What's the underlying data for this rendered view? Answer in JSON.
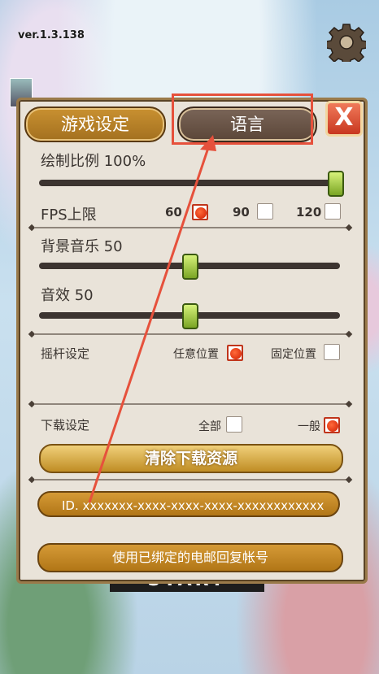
{
  "version": "ver.1.3.138",
  "background": {
    "start_text": "START"
  },
  "tabs": {
    "game_settings": "游戏设定",
    "language": "语言"
  },
  "close_label": "X",
  "render_scale": {
    "label": "绘制比例 100%",
    "value_percent": 100
  },
  "fps": {
    "label": "FPS上限",
    "options": [
      "60",
      "90",
      "120"
    ],
    "selected": "60"
  },
  "bgm": {
    "label": "背景音乐 50",
    "value": 50
  },
  "sfx": {
    "label": "音效 50",
    "value": 50
  },
  "joystick": {
    "label": "摇杆设定",
    "options": [
      "任意位置",
      "固定位置"
    ],
    "selected": "任意位置"
  },
  "download": {
    "label": "下载设定",
    "options": [
      "全部",
      "一般"
    ],
    "selected": "一般"
  },
  "buttons": {
    "clear_download": "清除下载资源",
    "id_text": "ID. xxxxxxx-xxxx-xxxx-xxxx-xxxxxxxxxxxx",
    "recover": "使用已绑定的电邮回复帐号"
  },
  "colors": {
    "highlight": "#e6513c",
    "panel_bg": "#e9e3d9",
    "gold": "#c08d24"
  }
}
